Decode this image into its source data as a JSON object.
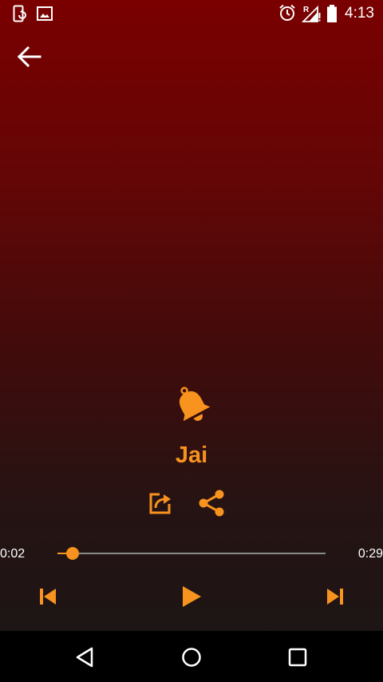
{
  "status_bar": {
    "time": "4:13",
    "icons": [
      "phone-sync-icon",
      "image-icon",
      "alarm-icon",
      "signal-roaming-icon",
      "battery-icon"
    ]
  },
  "toolbar": {
    "back_icon": "arrow-back-icon"
  },
  "ringtone": {
    "icon": "bell-icon",
    "title": "Jai"
  },
  "actions": {
    "set_icon": "open-in-new-icon",
    "share_icon": "share-icon"
  },
  "player": {
    "elapsed": "0:02",
    "duration": "0:29",
    "progress_fraction": 0.058,
    "prev_icon": "skip-previous-icon",
    "play_icon": "play-icon",
    "next_icon": "skip-next-icon"
  },
  "nav_bar": {
    "icons": [
      "triangle-back-icon",
      "circle-home-icon",
      "square-recents-icon"
    ]
  },
  "colors": {
    "accent": "#f7931e",
    "background_top": "#7a0000",
    "background_bottom": "#1d1515",
    "seek_track": "#8a8a8a"
  }
}
